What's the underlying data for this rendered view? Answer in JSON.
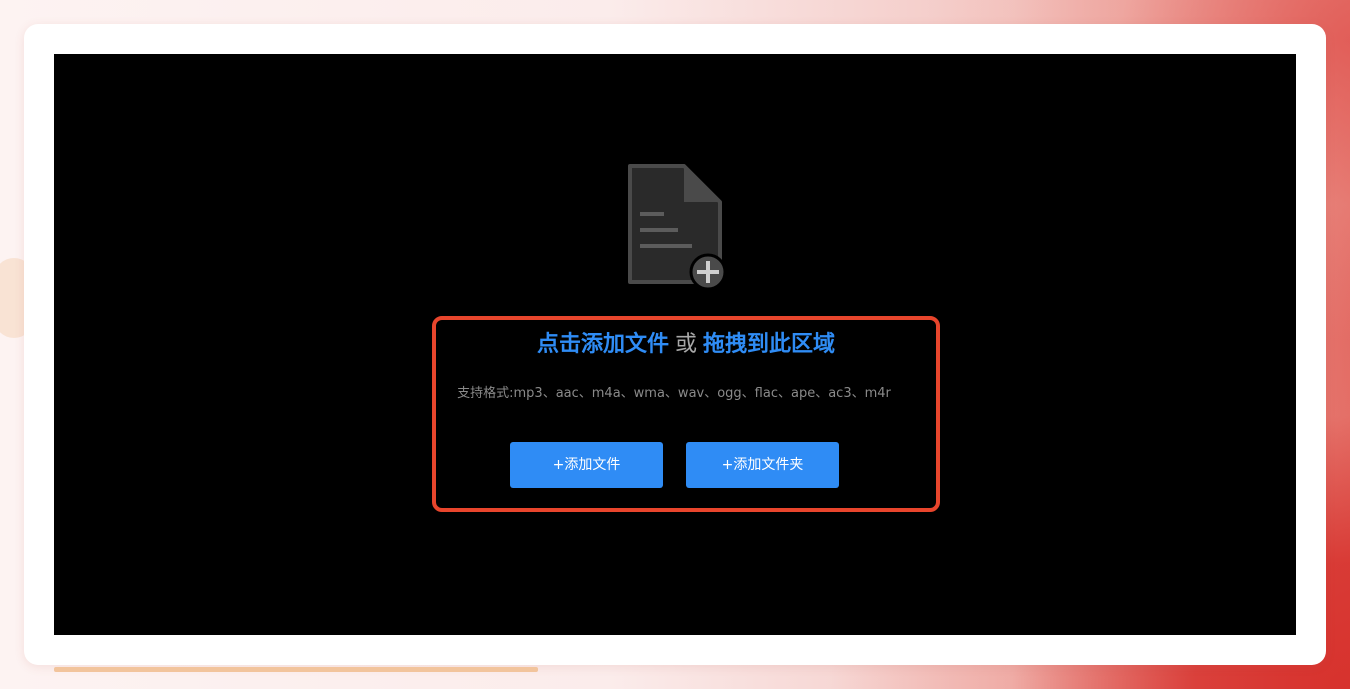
{
  "dropzone": {
    "icon": "file-add-icon",
    "title": {
      "click_add": "点击添加文件",
      "or": "或",
      "drag_here": "拖拽到此区域"
    },
    "formats_text": "支持格式:mp3、aac、m4a、wma、wav、ogg、flac、ape、ac3、m4r",
    "buttons": {
      "add_file": "+添加文件",
      "add_folder": "+添加文件夹"
    }
  },
  "colors": {
    "accent": "#2f8cf5",
    "highlight_frame": "#e8452c",
    "dropzone_bg": "#000000",
    "icon_gray": "#4a4a4a"
  }
}
